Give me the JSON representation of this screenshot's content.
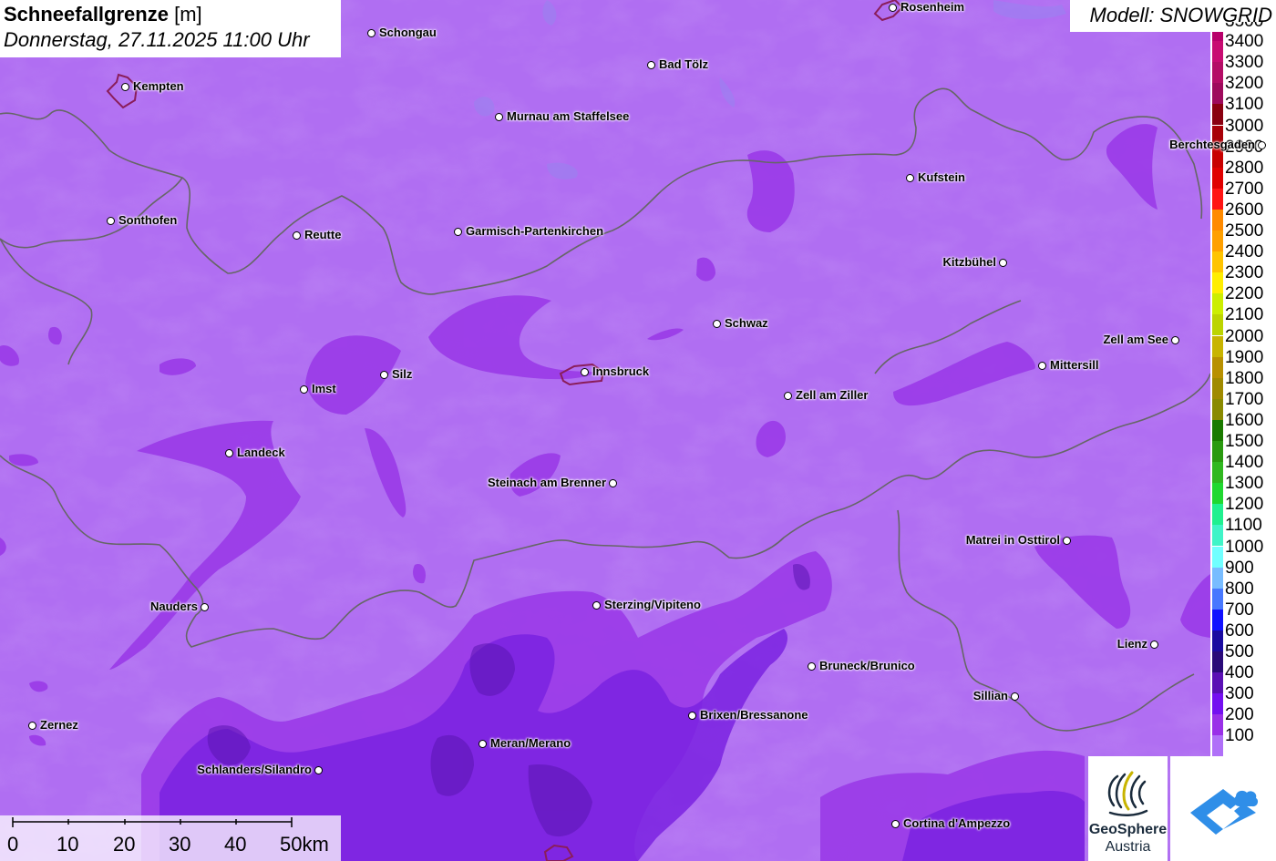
{
  "title": {
    "parameter": "Schneefallgrenze",
    "unit": "[m]",
    "datetime": "Donnerstag, 27.11.2025 11:00 Uhr"
  },
  "model": "Modell: SNOWGRID",
  "legend": [
    {
      "value": "3500",
      "color": "#b8006b"
    },
    {
      "value": "3400",
      "color": "#c80c72"
    },
    {
      "value": "3300",
      "color": "#b40d66"
    },
    {
      "value": "3200",
      "color": "#9e0a5c"
    },
    {
      "value": "3100",
      "color": "#8a0010"
    },
    {
      "value": "3000",
      "color": "#a80008"
    },
    {
      "value": "2900",
      "color": "#c80000"
    },
    {
      "value": "2800",
      "color": "#e00000"
    },
    {
      "value": "2700",
      "color": "#ff1414"
    },
    {
      "value": "2600",
      "color": "#ff8a00"
    },
    {
      "value": "2500",
      "color": "#ffa000"
    },
    {
      "value": "2400",
      "color": "#ffc400"
    },
    {
      "value": "2300",
      "color": "#ffee00"
    },
    {
      "value": "2200",
      "color": "#ccee00"
    },
    {
      "value": "2100",
      "color": "#bcd400"
    },
    {
      "value": "2000",
      "color": "#c8b400"
    },
    {
      "value": "1900",
      "color": "#b89000"
    },
    {
      "value": "1800",
      "color": "#a08a00"
    },
    {
      "value": "1700",
      "color": "#8a8a00"
    },
    {
      "value": "1600",
      "color": "#1a7a00"
    },
    {
      "value": "1500",
      "color": "#2a9a10"
    },
    {
      "value": "1400",
      "color": "#30b820"
    },
    {
      "value": "1300",
      "color": "#20d830"
    },
    {
      "value": "1200",
      "color": "#20f090"
    },
    {
      "value": "1100",
      "color": "#40f4c8"
    },
    {
      "value": "1000",
      "color": "#70ffff"
    },
    {
      "value": "900",
      "color": "#78bcff"
    },
    {
      "value": "800",
      "color": "#4878ff"
    },
    {
      "value": "700",
      "color": "#1010ff"
    },
    {
      "value": "600",
      "color": "#1a0aa0"
    },
    {
      "value": "500",
      "color": "#2a0a78"
    },
    {
      "value": "400",
      "color": "#5a10b4"
    },
    {
      "value": "300",
      "color": "#7410f0"
    },
    {
      "value": "200",
      "color": "#9a30e8"
    },
    {
      "value": "100",
      "color": "#b070f8"
    }
  ],
  "cities": [
    {
      "name": "Rosenheim",
      "side": "right"
    },
    {
      "name": "Schongau",
      "side": "right"
    },
    {
      "name": "Kempten",
      "side": "right"
    },
    {
      "name": "Bad Tölz",
      "side": "right"
    },
    {
      "name": "Murnau am Staffelsee",
      "side": "right"
    },
    {
      "name": "Berchtesgaden",
      "side": "left"
    },
    {
      "name": "Kufstein",
      "side": "right"
    },
    {
      "name": "Sonthofen",
      "side": "right"
    },
    {
      "name": "Reutte",
      "side": "right"
    },
    {
      "name": "Garmisch-Partenkirchen",
      "side": "right"
    },
    {
      "name": "Kitzbühel",
      "side": "left"
    },
    {
      "name": "Schwaz",
      "side": "right"
    },
    {
      "name": "Zell am See",
      "side": "left"
    },
    {
      "name": "Innsbruck",
      "side": "right"
    },
    {
      "name": "Silz",
      "side": "right"
    },
    {
      "name": "Imst",
      "side": "right"
    },
    {
      "name": "Mittersill",
      "side": "right"
    },
    {
      "name": "Zell am Ziller",
      "side": "right"
    },
    {
      "name": "Landeck",
      "side": "right"
    },
    {
      "name": "Steinach am Brenner",
      "side": "left"
    },
    {
      "name": "Matrei in Osttirol",
      "side": "left"
    },
    {
      "name": "Nauders",
      "side": "left"
    },
    {
      "name": "Sterzing/Vipiteno",
      "side": "right"
    },
    {
      "name": "Lienz",
      "side": "left"
    },
    {
      "name": "Bruneck/Brunico",
      "side": "right"
    },
    {
      "name": "Sillian",
      "side": "left"
    },
    {
      "name": "Brixen/Bressanone",
      "side": "right"
    },
    {
      "name": "Zernez",
      "side": "right"
    },
    {
      "name": "Meran/Merano",
      "side": "right"
    },
    {
      "name": "Schlanders/Silandro",
      "side": "left"
    },
    {
      "name": "Cortina d'Ampezzo",
      "side": "right"
    }
  ],
  "scalebar": {
    "labels": [
      "0",
      "10",
      "20",
      "30",
      "40",
      "50km"
    ]
  },
  "logos": {
    "geosphere_name": "GeoSphere",
    "geosphere_sub": "Austria"
  },
  "colors": {
    "base": "#b06ef2",
    "band_200": "#9a3ae8",
    "band_300": "#7a22e0",
    "band_400": "#5a14b0",
    "border": "#666666",
    "city_polygon": "#8a1d5a"
  }
}
